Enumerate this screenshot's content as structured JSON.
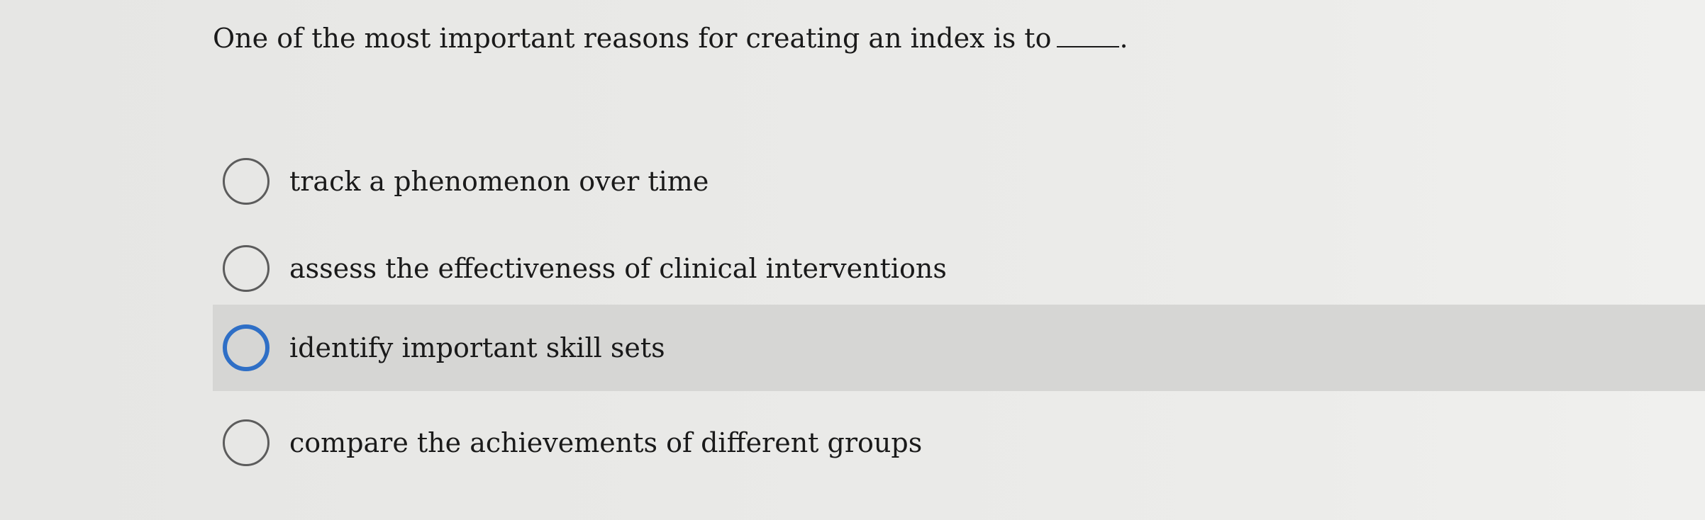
{
  "question": {
    "text": "One of the most important reasons for creating an index is to",
    "blank_suffix": "."
  },
  "options": [
    {
      "label": "track a phenomenon over time",
      "selected": false
    },
    {
      "label": "assess the effectiveness of clinical interventions",
      "selected": false
    },
    {
      "label": "identify important skill sets",
      "selected": false,
      "hovered": true
    },
    {
      "label": "compare the achievements of different groups",
      "selected": false
    }
  ],
  "colors": {
    "hover_row": "#d6d6d4",
    "focus_ring": "#2f6fc6"
  }
}
